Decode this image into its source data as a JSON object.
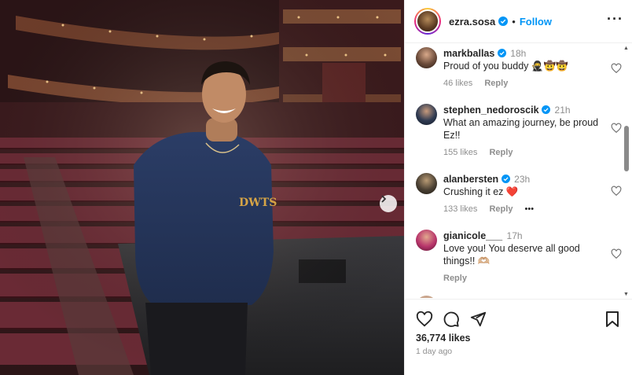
{
  "post": {
    "author": "ezra.sosa",
    "follow_label": "Follow",
    "separator": "•",
    "more_label": "···",
    "likes": "36,774 likes",
    "date": "1 day ago"
  },
  "comments": [
    {
      "user": "markballas",
      "verified": true,
      "time": "18h",
      "text": "Proud of you buddy 🥷🤠🤠",
      "likes": "46 likes",
      "reply": "Reply",
      "avatar_color": "#6b4b3a"
    },
    {
      "user": "stephen_nedoroscik",
      "verified": true,
      "time": "21h",
      "text": "What an amazing journey, be proud Ez!!",
      "likes": "155 likes",
      "reply": "Reply",
      "avatar_color": "#2f3b52"
    },
    {
      "user": "alanbersten",
      "verified": true,
      "time": "23h",
      "text": "Crushing it ez ❤️",
      "likes": "133 likes",
      "reply": "Reply",
      "more": "•••",
      "avatar_color": "#4a4033"
    },
    {
      "user": "gianicole___",
      "verified": false,
      "time": "17h",
      "text": "Love you! You deserve all good things!! 🫶🏼",
      "likes": "",
      "reply": "Reply",
      "avatar_color": "#b8356b"
    }
  ],
  "icons": {
    "verified": "verified-badge-icon",
    "heart": "heart-icon",
    "comment": "comment-icon",
    "share": "share-icon",
    "save": "bookmark-icon",
    "next": "chevron-right-icon"
  },
  "colors": {
    "accent": "#0095f6",
    "verified": "#0095f6",
    "heart_red": "#ed1c3a"
  }
}
